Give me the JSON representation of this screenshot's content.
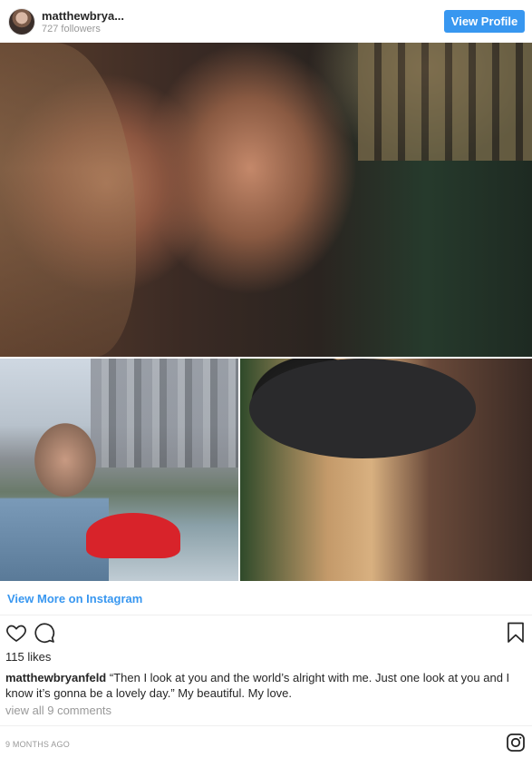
{
  "header": {
    "username": "matthewbrya...",
    "followers": "727 followers",
    "view_profile_label": "View Profile"
  },
  "post": {
    "view_more_label": "View More on Instagram",
    "likes": "115 likes",
    "caption_user": "matthewbryanfeld",
    "caption_text": "“Then I look at you and the world’s alright with me. Just one look at you and I know it’s gonna be a lovely day.” My beautiful. My love.",
    "comments_link": "view all 9 comments",
    "timestamp": "9 MONTHS AGO"
  },
  "icons": {
    "like": "heart-icon",
    "comment": "comment-icon",
    "save": "bookmark-icon",
    "brand": "instagram-icon"
  },
  "colors": {
    "accent": "#3897f0",
    "text": "#262626",
    "muted": "#999999"
  }
}
